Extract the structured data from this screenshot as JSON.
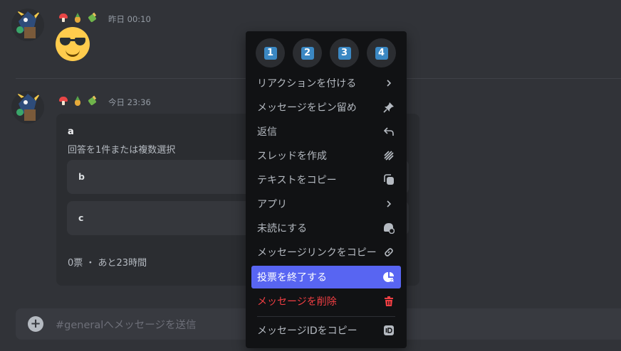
{
  "messages": [
    {
      "timestamp": "昨日 00:10"
    },
    {
      "timestamp": "今日 23:36"
    }
  ],
  "poll": {
    "question": "a",
    "hint": "回答を1件または複数選択",
    "options": [
      "b",
      "c"
    ],
    "footer": "0票 ・ あと23時間"
  },
  "composer": {
    "placeholder": "#generalへメッセージを送信"
  },
  "context_menu": {
    "quick_reactions": [
      "1",
      "2",
      "3",
      "4"
    ],
    "items": [
      {
        "label": "リアクションを付ける",
        "icon": "chevron-right-icon"
      },
      {
        "label": "メッセージをピン留め",
        "icon": "pin-icon"
      },
      {
        "label": "返信",
        "icon": "reply-icon"
      },
      {
        "label": "スレッドを作成",
        "icon": "threads-icon"
      },
      {
        "label": "テキストをコピー",
        "icon": "copy-icon"
      },
      {
        "label": "アプリ",
        "icon": "chevron-right-icon"
      },
      {
        "label": "未読にする",
        "icon": "mark-unread-icon"
      },
      {
        "label": "メッセージリンクをコピー",
        "icon": "link-icon"
      },
      {
        "label": "投票を終了する",
        "icon": "end-poll-icon",
        "highlighted": true
      },
      {
        "label": "メッセージを削除",
        "icon": "trash-icon",
        "danger": true
      },
      {
        "label": "メッセージIDをコピー",
        "icon": "id-icon"
      }
    ]
  },
  "colors": {
    "background": "#313338",
    "menu_background": "#111214",
    "highlight": "#5865f2",
    "danger": "#f23f43",
    "keycap": "#3b88c3"
  }
}
